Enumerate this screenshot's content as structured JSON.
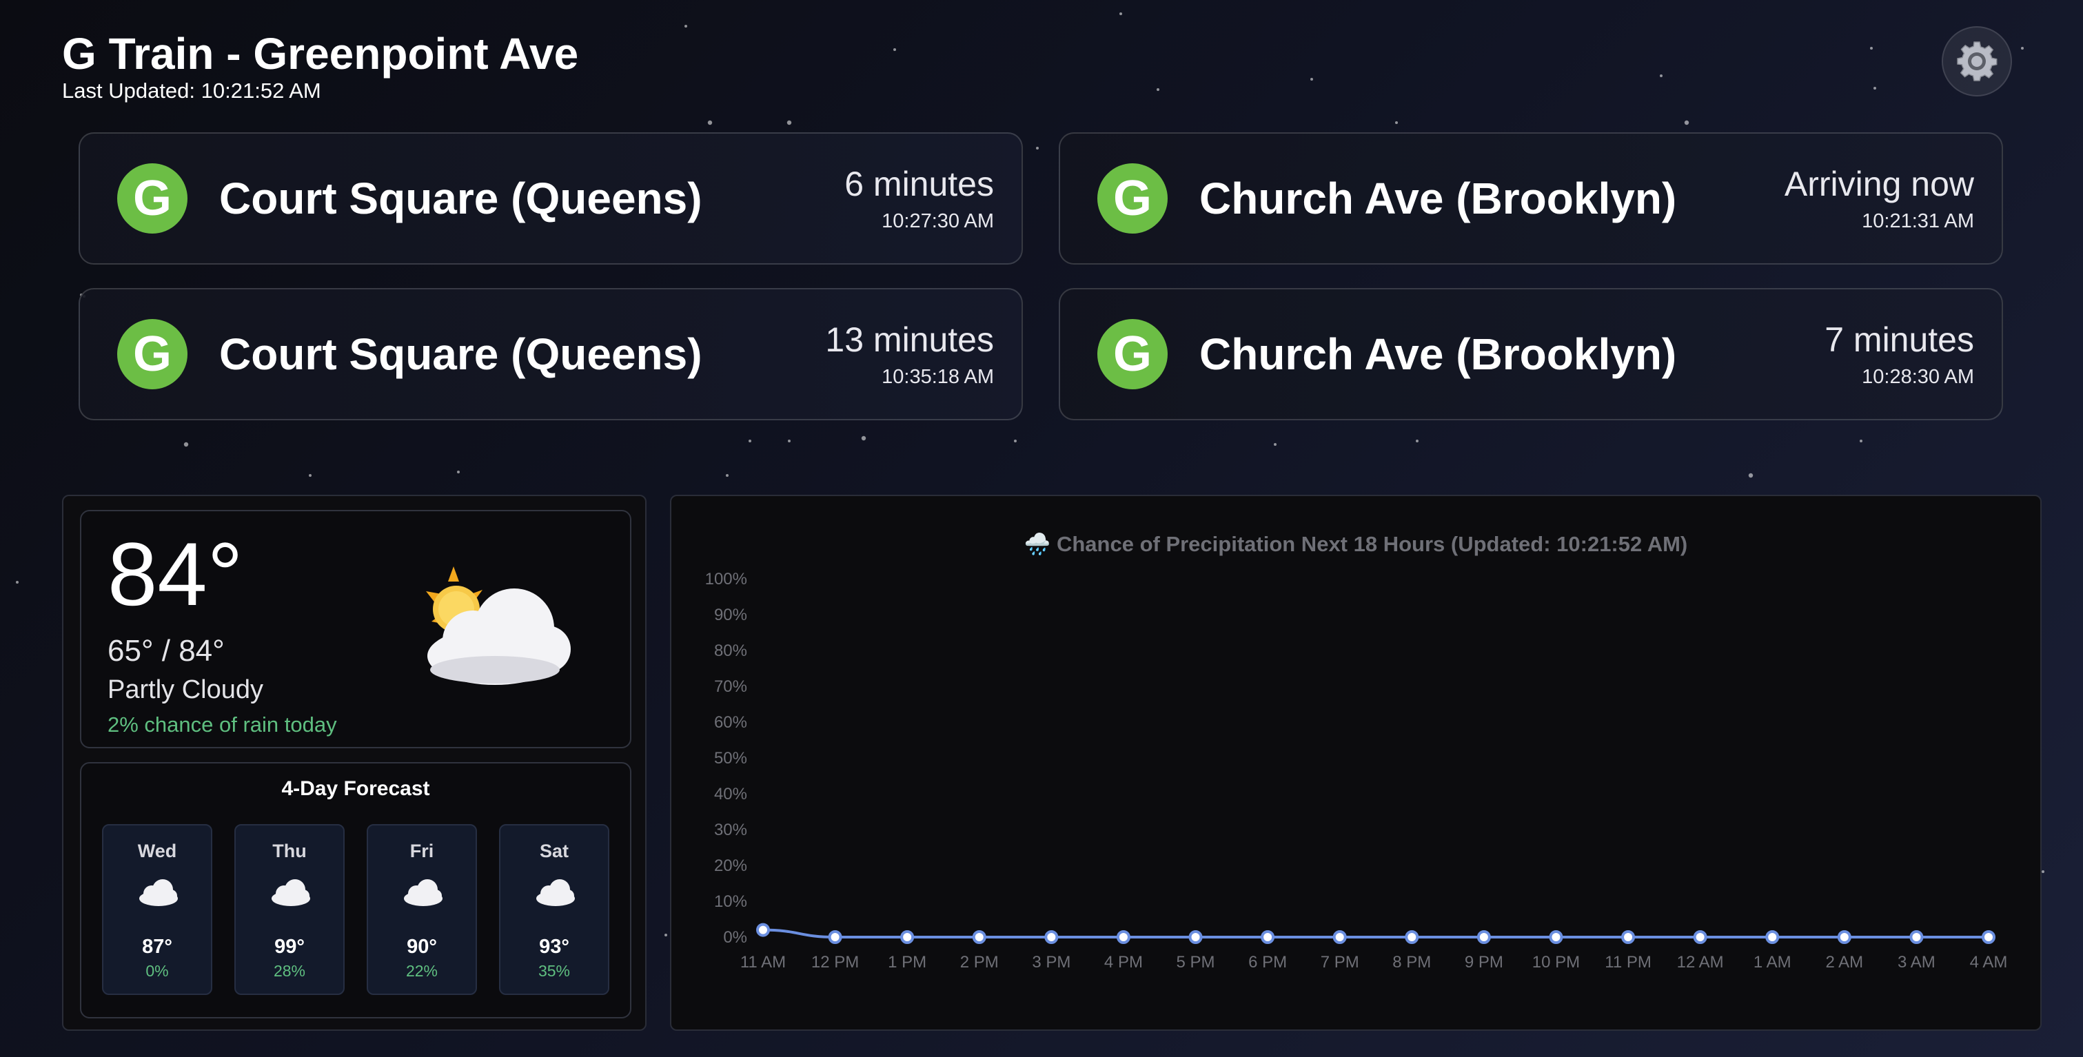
{
  "header": {
    "title": "G Train - Greenpoint Ave",
    "last_updated": "Last Updated: 10:21:52 AM"
  },
  "settings": {
    "icon": "gear-icon"
  },
  "trains": [
    {
      "line": "G",
      "destination": "Court Square (Queens)",
      "eta": "6 minutes",
      "time": "10:27:30 AM"
    },
    {
      "line": "G",
      "destination": "Church Ave (Brooklyn)",
      "eta": "Arriving now",
      "time": "10:21:31 AM"
    },
    {
      "line": "G",
      "destination": "Court Square (Queens)",
      "eta": "13 minutes",
      "time": "10:35:18 AM"
    },
    {
      "line": "G",
      "destination": "Church Ave (Brooklyn)",
      "eta": "7 minutes",
      "time": "10:28:30 AM"
    }
  ],
  "colors": {
    "g_line": "#6cbe45",
    "rain_text": "#5fbf80",
    "chart_line": "#6b8fe0"
  },
  "weather": {
    "current_temp": "84°",
    "hi_lo": "65° / 84°",
    "condition": "Partly Cloudy",
    "rain_today": "2% chance of rain today",
    "icon": "partly-cloudy-icon",
    "forecast_title": "4-Day Forecast",
    "forecast": [
      {
        "day": "Wed",
        "temp": "87°",
        "rain": "0%",
        "icon": "cloud-icon"
      },
      {
        "day": "Thu",
        "temp": "99°",
        "rain": "28%",
        "icon": "cloud-icon"
      },
      {
        "day": "Fri",
        "temp": "90°",
        "rain": "22%",
        "icon": "cloud-icon"
      },
      {
        "day": "Sat",
        "temp": "93°",
        "rain": "35%",
        "icon": "cloud-icon"
      }
    ]
  },
  "chart_data": {
    "type": "line",
    "title": "🌧️ Chance of Precipitation Next 18 Hours (Updated: 10:21:52 AM)",
    "categories": [
      "11 AM",
      "12 PM",
      "1 PM",
      "2 PM",
      "3 PM",
      "4 PM",
      "5 PM",
      "6 PM",
      "7 PM",
      "8 PM",
      "9 PM",
      "10 PM",
      "11 PM",
      "12 AM",
      "1 AM",
      "2 AM",
      "3 AM",
      "4 AM"
    ],
    "values": [
      2,
      0,
      0,
      0,
      0,
      0,
      0,
      0,
      0,
      0,
      0,
      0,
      0,
      0,
      0,
      0,
      0,
      0
    ],
    "yticks": [
      "0%",
      "10%",
      "20%",
      "30%",
      "40%",
      "50%",
      "60%",
      "70%",
      "80%",
      "90%",
      "100%"
    ],
    "ylim": [
      0,
      100
    ],
    "grid": false,
    "legend": false
  }
}
